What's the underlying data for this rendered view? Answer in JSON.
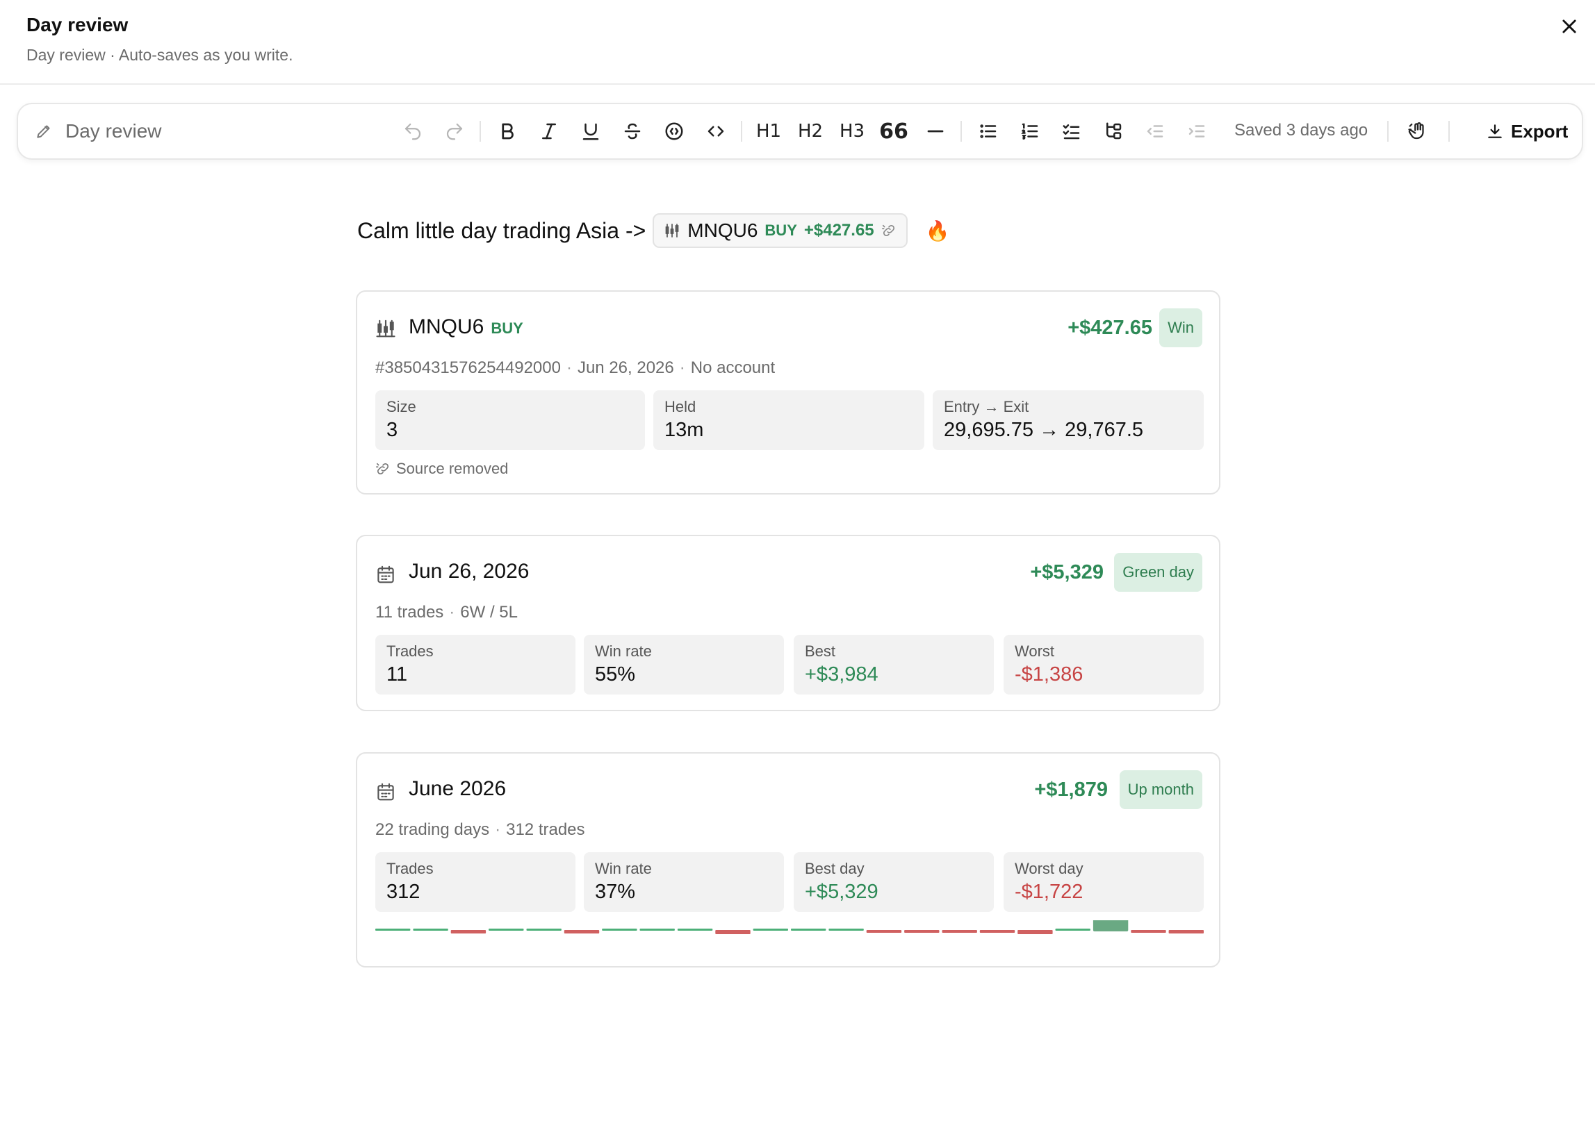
{
  "header": {
    "title": "Day review",
    "subtitle": "Day review · Auto-saves as you write."
  },
  "toolbar": {
    "doc_title": "Day review",
    "saved": "Saved 3 days ago",
    "export_label": "Export",
    "buttons": [
      "undo",
      "redo",
      "bold",
      "italic",
      "underline",
      "strikethrough",
      "spoiler",
      "code",
      "heading-1",
      "heading-2",
      "heading-3",
      "quote",
      "divider",
      "bullet-list",
      "numbered-list",
      "task-list",
      "toggle",
      "outdent",
      "indent"
    ],
    "h1": "H1",
    "h2": "H2",
    "h3": "H3",
    "quote": "66"
  },
  "content": {
    "line_text": "Calm little day trading Asia ->",
    "chip": {
      "symbol": "MNQU6",
      "side": "BUY",
      "pnl": "+$427.65"
    },
    "emoji": "🔥"
  },
  "trade_card": {
    "symbol": "MNQU6",
    "side": "BUY",
    "pnl": "+$427.65",
    "badge": "Win",
    "meta": [
      "#3850431576254492000",
      "Jun 26, 2026",
      "No account"
    ],
    "stats": [
      {
        "label": "Size",
        "value": "3"
      },
      {
        "label": "Held",
        "value": "13m"
      },
      {
        "label": "Entry → Exit",
        "value": "29,695.75 → 29,767.5"
      }
    ],
    "source_note": "Source removed"
  },
  "day_card": {
    "title": "Jun 26, 2026",
    "pnl": "+$5,329",
    "badge": "Green day",
    "meta": [
      "11 trades",
      "6W / 5L"
    ],
    "stats": [
      {
        "label": "Trades",
        "value": "11"
      },
      {
        "label": "Win rate",
        "value": "55%"
      },
      {
        "label": "Best",
        "value": "+$3,984"
      },
      {
        "label": "Worst",
        "value": "-$1,386"
      }
    ]
  },
  "month_card": {
    "title": "June 2026",
    "pnl": "+$1,879",
    "badge": "Up month",
    "meta": [
      "22 trading days",
      "312 trades"
    ],
    "stats": [
      {
        "label": "Trades",
        "value": "312"
      },
      {
        "label": "Win rate",
        "value": "37%"
      },
      {
        "label": "Best day",
        "value": "+$5,329"
      },
      {
        "label": "Worst day",
        "value": "-$1,722"
      }
    ],
    "daily_pnl": [
      180,
      160,
      -1100,
      170,
      200,
      -1200,
      190,
      210,
      150,
      -1300,
      160,
      180,
      170,
      -900,
      -950,
      -870,
      -880,
      -1400,
      220,
      5329,
      -1000,
      -1050
    ],
    "colors": {
      "positive": "#4caf78",
      "negative": "#d06060",
      "highlight": "#6aa983"
    }
  },
  "colors": {
    "green": "#2e8a57",
    "red": "#c74444",
    "badge_bg": "#dcefe3"
  }
}
